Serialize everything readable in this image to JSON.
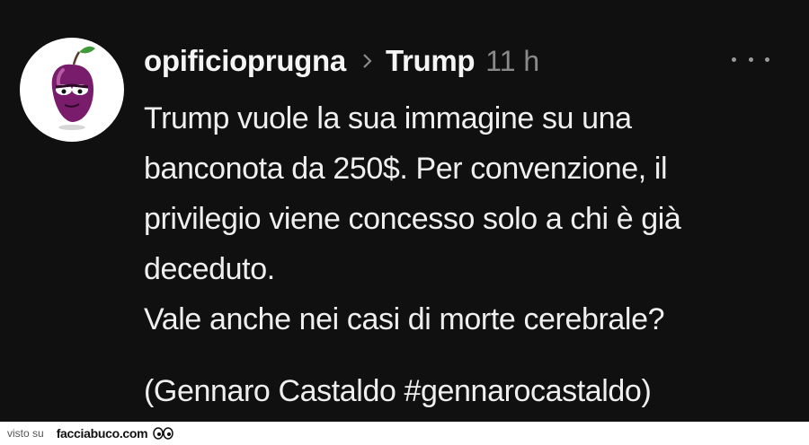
{
  "post": {
    "username": "opificioprugna",
    "topic": "Trump",
    "time": "11 h",
    "lines": [
      "Trump vuole la sua immagine su una",
      "banconota da 250$. Per convenzione, il",
      "privilegio viene concesso solo a chi è già",
      "deceduto.",
      "Vale anche nei casi di  morte cerebrale?"
    ],
    "signature": "(Gennaro Castaldo #gennarocastaldo)"
  },
  "icons": {
    "avatar": "plum-character-icon",
    "separator": "chevron-right-icon",
    "menu": "more-horizontal-icon",
    "watermark": "eyes-icon"
  },
  "colors": {
    "background": "#101010",
    "text": "#efefef",
    "muted": "#8a8a8a",
    "avatar_bg": "#ffffff",
    "plum": "#7a1c6c"
  },
  "watermark": {
    "prefix": "visto su",
    "site": "facciabuco.com"
  }
}
